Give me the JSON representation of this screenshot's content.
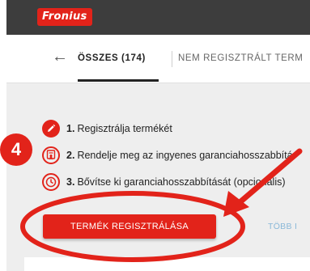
{
  "header": {
    "logo_text": "Fronius"
  },
  "tabs": {
    "back_glyph": "←",
    "all_label": "ÖSSZES (174)",
    "unregistered_label": "NEM REGISZTRÁLT TERM"
  },
  "steps": [
    {
      "number": "1.",
      "text": "Regisztrálja termékét",
      "icon": "pencil-icon"
    },
    {
      "number": "2.",
      "text": "Rendelje meg az ingyenes garanciahosszabbítá",
      "icon": "certificate-icon"
    },
    {
      "number": "3.",
      "text": "Bővítse ki garanciahosszabbítását (opcionális)",
      "icon": "clock-icon"
    }
  ],
  "actions": {
    "register_label": "TERMÉK REGISZTRÁLÁSA",
    "more_label": "TÖBB I"
  },
  "annotation": {
    "badge_number": "4"
  },
  "colors": {
    "brand_red": "#e2231a",
    "header_dark": "#3d3d3d"
  }
}
